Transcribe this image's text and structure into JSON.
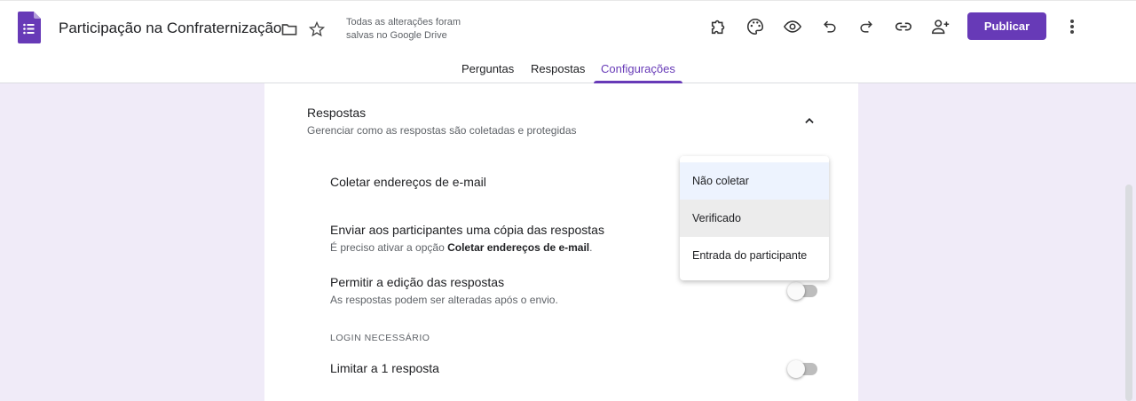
{
  "header": {
    "title": "Participação na Confraternização",
    "saved_line1": "Todas as alterações foram",
    "saved_line2": "salvas no Google Drive",
    "publish_label": "Publicar"
  },
  "tabs": [
    {
      "label": "Perguntas"
    },
    {
      "label": "Respostas"
    },
    {
      "label": "Configurações",
      "active": true
    }
  ],
  "section": {
    "title": "Respostas",
    "subtitle": "Gerenciar como as respostas são coletadas e protegidas"
  },
  "settings": {
    "collect_email": "Coletar endereços de e-mail",
    "send_copy": "Enviar aos participantes uma cópia das respostas",
    "send_copy_hint_pre": "É preciso ativar a opção ",
    "send_copy_hint_bold": "Coletar endereços de e-mail",
    "send_copy_hint_post": ".",
    "allow_edit": "Permitir a edição das respostas",
    "allow_edit_hint": "As respostas podem ser alteradas após o envio.",
    "login_heading": "LOGIN NECESSÁRIO",
    "limit_one": "Limitar a 1 resposta"
  },
  "dropdown": {
    "options": [
      "Não coletar",
      "Verificado",
      "Entrada do participante"
    ]
  },
  "colors": {
    "accent": "#673ab7",
    "background": "#f0ebf8"
  }
}
